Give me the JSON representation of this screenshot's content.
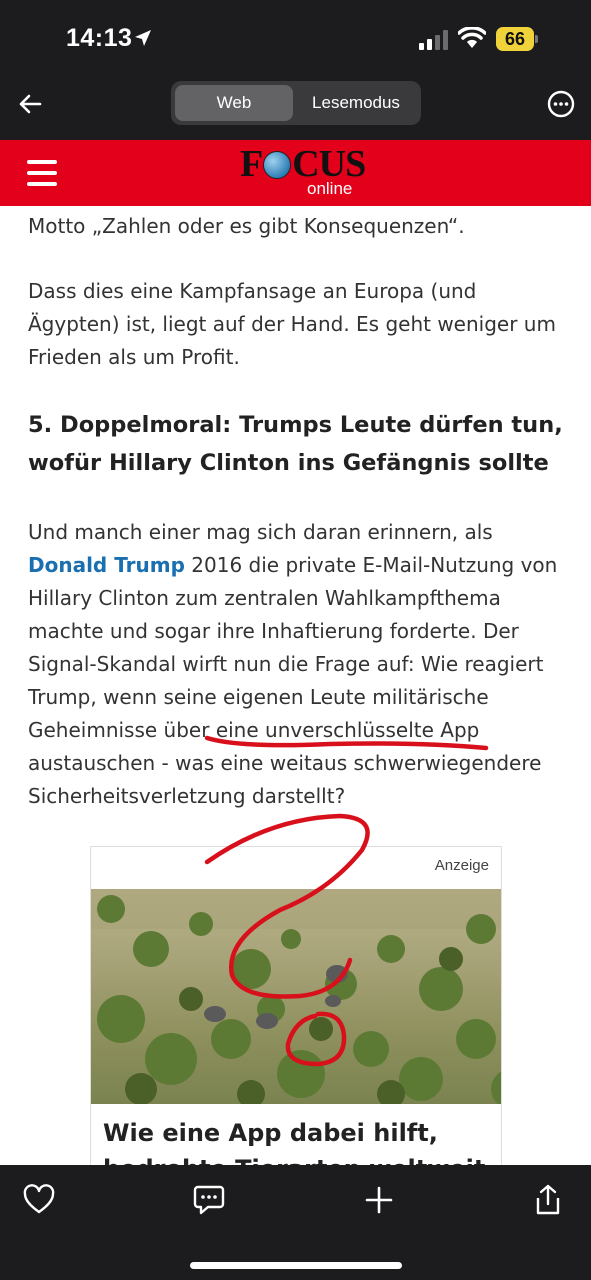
{
  "status_bar": {
    "time": "14:13",
    "battery": "66"
  },
  "browser": {
    "segment_web": "Web",
    "segment_reader": "Lesemodus"
  },
  "site": {
    "logo_focus_a": "F",
    "logo_focus_b": "CUS",
    "logo_online": "online"
  },
  "article": {
    "para1": "Motto „Zahlen oder es gibt Konsequenzen“.",
    "para2": "Dass dies eine Kampfansage an Europa (und Ägypten) ist, liegt auf der Hand. Es geht weniger um Frieden als um Profit.",
    "heading": "5. Doppelmoral: Trumps Leute dürfen tun, wofür Hillary Clinton ins Gefängnis sollte",
    "para3_start": "Und manch einer mag sich daran erinnern, als",
    "para3_link": "Donald Trump",
    "para3_rest": " 2016 die private E-Mail-Nutzung von Hillary Clinton zum zentralen Wahlkampfthema machte und sogar ihre Inhaftierung forderte. Der Signal-Skandal wirft nun die Frage auf: Wie reagiert Trump, wenn seine eigenen Leute militärische Geheimnisse über eine unverschlüsselte App austauschen - was eine weitaus schwerwiegendere Sicherheitsverletzung darstellt?"
  },
  "ad": {
    "label": "Anzeige",
    "title": "Wie eine App dabei hilft, bedrohte Tierarten weltweit"
  },
  "colors": {
    "brand_red": "#e2001a",
    "link_blue": "#1a6fb0",
    "annotation_red": "#d8101c"
  },
  "icons": [
    "location-arrow-icon",
    "signal-icon",
    "wifi-icon",
    "back-arrow-icon",
    "more-icon",
    "menu-icon",
    "heart-icon",
    "comment-icon",
    "plus-icon",
    "share-icon"
  ]
}
